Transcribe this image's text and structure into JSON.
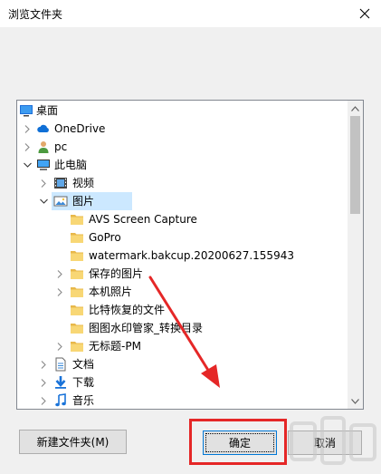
{
  "window": {
    "title": "浏览文件夹",
    "close_glyph": "✕"
  },
  "tree": {
    "items": [
      {
        "label": "桌面",
        "icon": "desktop-icon",
        "expander": "none"
      },
      {
        "label": "OneDrive",
        "icon": "cloud-icon",
        "expander": "collapsed"
      },
      {
        "label": "pc",
        "icon": "user-icon",
        "expander": "collapsed"
      },
      {
        "label": "此电脑",
        "icon": "computer-icon",
        "expander": "expanded"
      },
      {
        "label": "视频",
        "icon": "video-folder-icon",
        "expander": "collapsed"
      },
      {
        "label": "图片",
        "icon": "pictures-folder-icon",
        "expander": "expanded",
        "selected": true
      },
      {
        "label": "AVS Screen Capture",
        "icon": "folder-icon",
        "expander": "none"
      },
      {
        "label": "GoPro",
        "icon": "folder-icon",
        "expander": "none"
      },
      {
        "label": "watermark.bakcup.20200627.155943",
        "icon": "folder-icon",
        "expander": "none"
      },
      {
        "label": "保存的图片",
        "icon": "folder-icon",
        "expander": "collapsed"
      },
      {
        "label": "本机照片",
        "icon": "folder-icon",
        "expander": "collapsed"
      },
      {
        "label": "比特恢复的文件",
        "icon": "folder-icon",
        "expander": "none"
      },
      {
        "label": "图图水印管家_转换目录",
        "icon": "folder-icon",
        "expander": "none"
      },
      {
        "label": "无标题-PM",
        "icon": "folder-icon",
        "expander": "collapsed"
      },
      {
        "label": "文档",
        "icon": "documents-icon",
        "expander": "collapsed"
      },
      {
        "label": "下载",
        "icon": "download-icon",
        "expander": "collapsed"
      },
      {
        "label": "音乐",
        "icon": "music-icon",
        "expander": "collapsed"
      }
    ]
  },
  "buttons": {
    "new_folder": "新建文件夹(M)",
    "ok": "确定",
    "cancel": "取消"
  },
  "colors": {
    "selection": "#cce8ff",
    "annotation": "#e52727",
    "folder": "#f8d775"
  }
}
